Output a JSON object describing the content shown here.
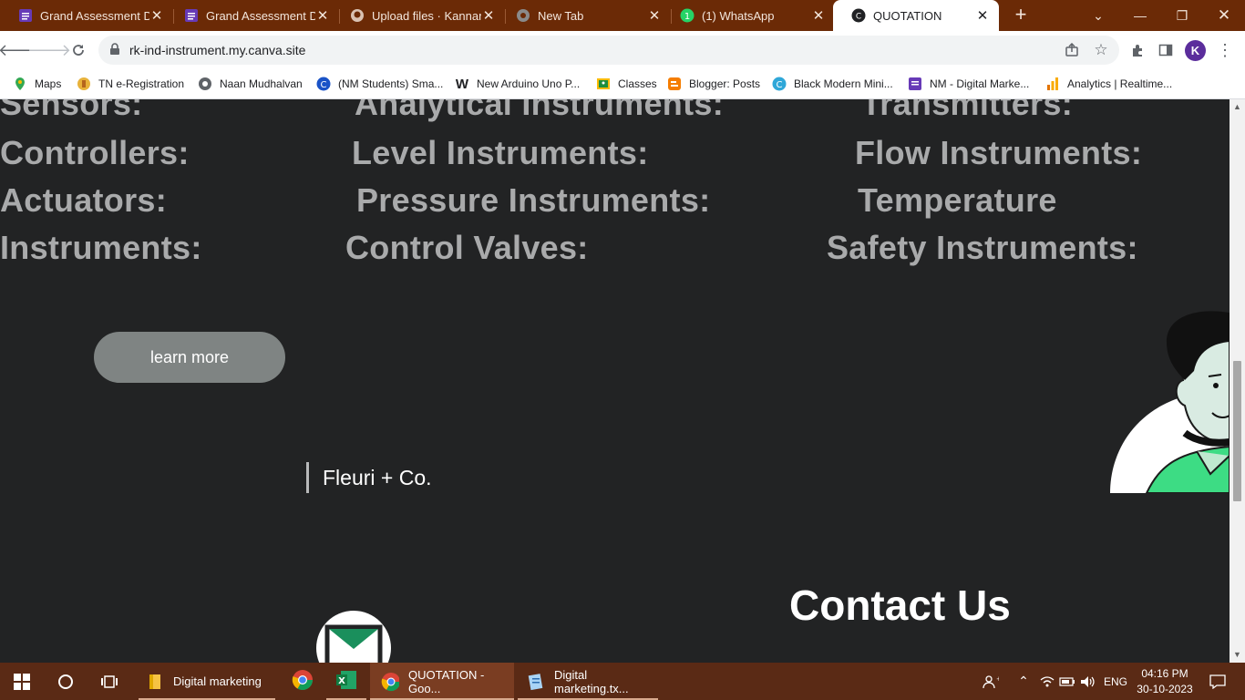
{
  "browser": {
    "tabs": [
      {
        "title": "Grand Assessment Di",
        "icon": "forms-icon",
        "active": false
      },
      {
        "title": "Grand Assessment Di",
        "icon": "forms-icon",
        "active": false
      },
      {
        "title": "Upload files · Kannan",
        "icon": "github-icon",
        "active": false
      },
      {
        "title": "New Tab",
        "icon": "chrome-icon",
        "active": false
      },
      {
        "title": "(1) WhatsApp",
        "icon": "whatsapp-icon",
        "active": false
      },
      {
        "title": "QUOTATION",
        "icon": "canva-icon",
        "active": true
      }
    ],
    "url": "rk-ind-instrument.my.canva.site",
    "profile_initial": "K",
    "bookmarks": [
      {
        "label": "Maps"
      },
      {
        "label": "TN e-Registration"
      },
      {
        "label": "Naan Mudhalvan"
      },
      {
        "label": "(NM Students) Sma..."
      },
      {
        "label": "New Arduino Uno P..."
      },
      {
        "label": "Classes"
      },
      {
        "label": "Blogger: Posts"
      },
      {
        "label": "Black Modern Mini..."
      },
      {
        "label": "NM - Digital Marke..."
      },
      {
        "label": "Analytics | Realtime..."
      }
    ]
  },
  "page": {
    "categories": {
      "col1": [
        "Sensors:",
        "Controllers:",
        "Actuators:",
        "Instruments:"
      ],
      "col2": [
        "Analytical Instruments:",
        "Level Instruments:",
        "Pressure Instruments:",
        "Control Valves:"
      ],
      "col3": [
        "Transmitters:",
        "Flow Instruments:",
        "Temperature",
        "Safety Instruments:"
      ]
    },
    "learn_more": "learn more",
    "brand": "Fleuri + Co.",
    "contact_title": "Contact Us"
  },
  "taskbar": {
    "items": [
      {
        "label": "Digital marketing",
        "icon": "folder-icon"
      },
      {
        "label": "",
        "icon": "chrome-icon"
      },
      {
        "label": "",
        "icon": "excel-icon"
      },
      {
        "label": "QUOTATION - Goo...",
        "icon": "chrome-icon"
      },
      {
        "label": "Digital marketing.tx...",
        "icon": "notepad-icon"
      }
    ],
    "language": "ENG",
    "time": "04:16 PM",
    "date": "30-10-2023"
  },
  "colors": {
    "page_bg": "#222324",
    "category_text": "#a9aaab",
    "button_bg": "#7f8483",
    "tabstrip_bg": "#6b2a06",
    "taskbar_bg": "#5a2a15",
    "illustration_green": "#3ddc84"
  }
}
